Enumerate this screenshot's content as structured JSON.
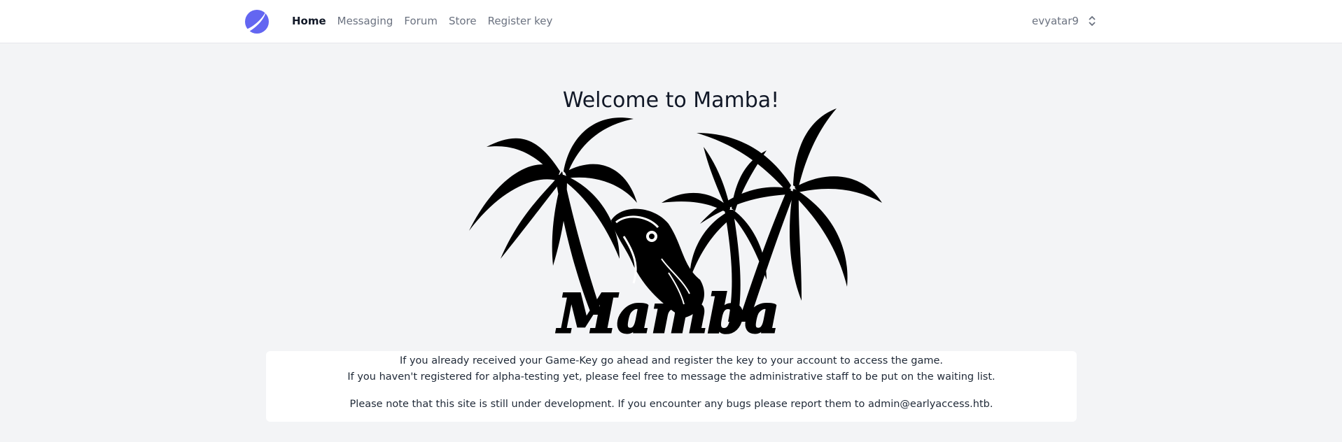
{
  "nav": {
    "logo_icon": "planet-logo-icon",
    "items": [
      {
        "label": "Home",
        "active": true
      },
      {
        "label": "Messaging",
        "active": false
      },
      {
        "label": "Forum",
        "active": false
      },
      {
        "label": "Store",
        "active": false
      },
      {
        "label": "Register key",
        "active": false
      }
    ],
    "user": {
      "name": "evyatar9",
      "icon": "chevron-updown-icon"
    }
  },
  "main": {
    "title": "Welcome to Mamba!",
    "banner": {
      "text": "Mamba",
      "icon": "palm-trees-snake-logo"
    },
    "info": {
      "line1": "If you already received your Game-Key go ahead and register the key to your account to access the game.",
      "line2": "If you haven't registered for alpha-testing yet, please feel free to message the administrative staff to be put on the waiting list.",
      "line3": "Please note that this site is still under development. If you encounter any bugs please report them to admin@earlyaccess.htb."
    }
  },
  "colors": {
    "accent": "#6366f1",
    "background": "#f3f4f6",
    "card": "#ffffff"
  }
}
